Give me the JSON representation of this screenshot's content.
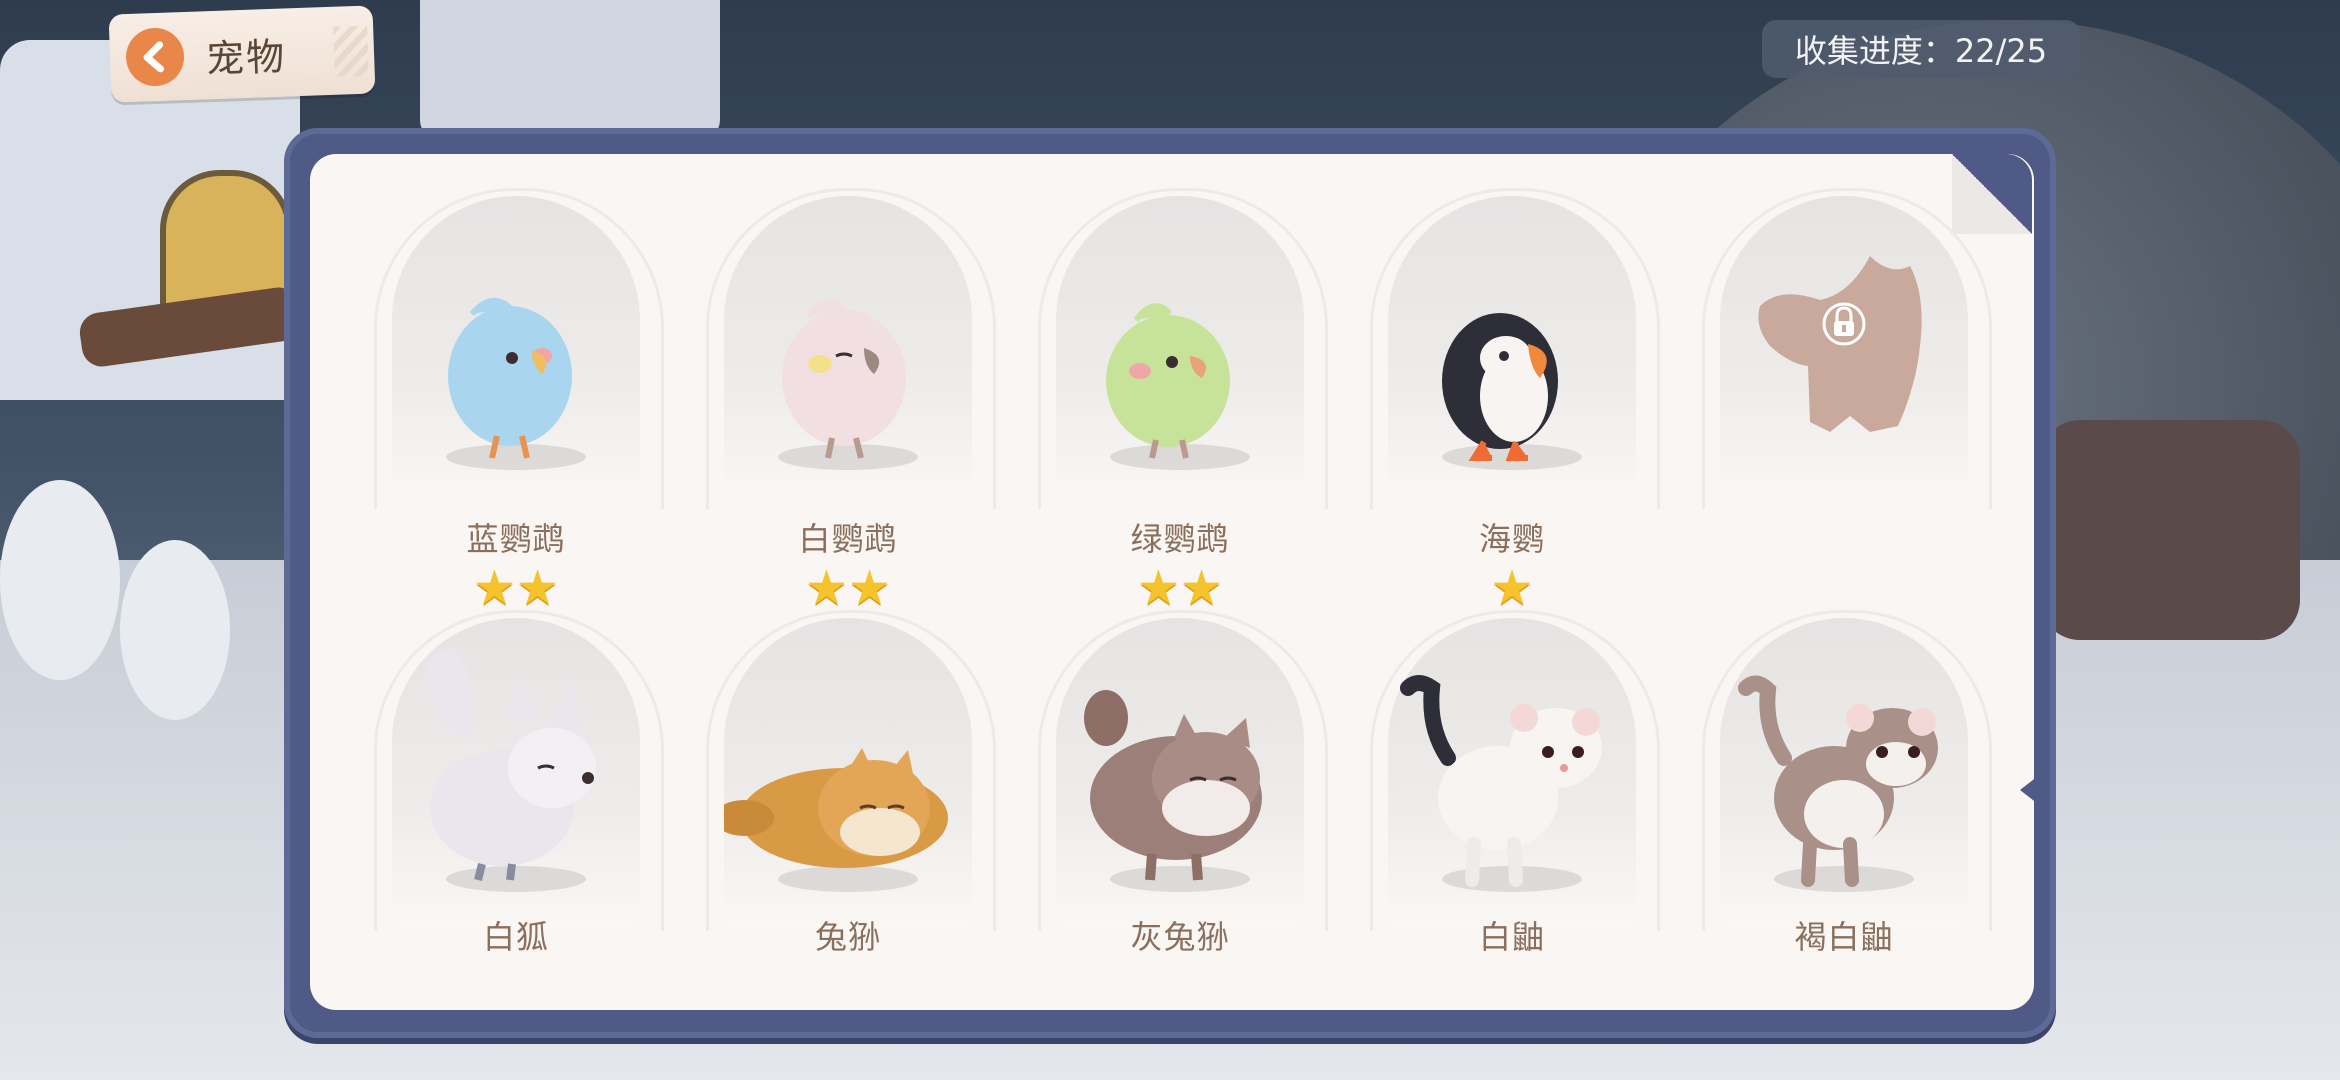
{
  "header": {
    "back_label": "宠物",
    "progress_text": "收集进度：22/25"
  },
  "pets": [
    {
      "name": "蓝鹦鹉",
      "stars": "★★",
      "color": "#a9d6ee"
    },
    {
      "name": "白鹦鹉",
      "stars": "★★",
      "color": "#f1dfe2"
    },
    {
      "name": "绿鹦鹉",
      "stars": "★★",
      "color": "#c7e39a"
    },
    {
      "name": "海鹦",
      "stars": "★",
      "color": "#2e2e38"
    },
    {
      "name": "",
      "stars": "",
      "locked": true,
      "color": "#c9a99c"
    },
    {
      "name": "白狐",
      "color": "#e9e6ee"
    },
    {
      "name": "兔狲",
      "color": "#d99a45"
    },
    {
      "name": "灰兔狲",
      "color": "#9c7f78"
    },
    {
      "name": "白鼬",
      "color": "#f7f4f2"
    },
    {
      "name": "褐白鼬",
      "color": "#a99089"
    }
  ],
  "colors": {
    "panel_frame": "#4f5b86",
    "panel_bg": "#faf6f3",
    "star": "#f5c32c",
    "back_icon": "#e9874a"
  }
}
